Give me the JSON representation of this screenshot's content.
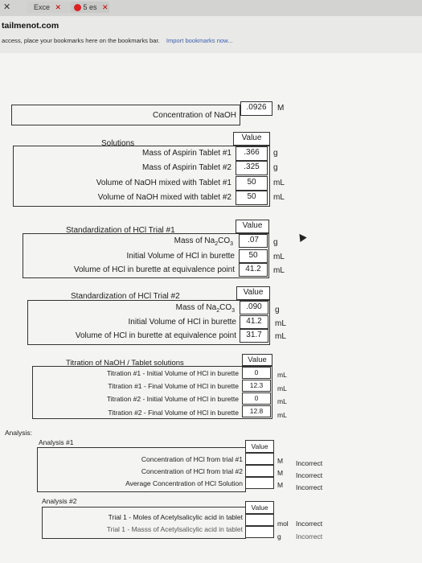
{
  "browser": {
    "tab1": "Exce",
    "tab2": "5 es",
    "url": "tailmenot.com",
    "bookmarks_hint": "access, place your bookmarks here on the bookmarks bar.",
    "bookmarks_link": "Import bookmarks now..."
  },
  "naoh": {
    "label": "Concentration of NaOH",
    "value": ".0926",
    "unit": "M"
  },
  "solutions": {
    "title": "Solutions",
    "value_header": "Value",
    "rows": [
      {
        "label": "Mass of Aspirin Tablet #1",
        "value": ".366",
        "unit": "g"
      },
      {
        "label": "Mass of Aspirin Tablet #2",
        "value": ".325",
        "unit": "g"
      },
      {
        "label": "Volume of NaOH mixed with Tablet #1",
        "value": "50",
        "unit": "mL"
      },
      {
        "label": "Volume of NaOH mixed with tablet #2",
        "value": "50",
        "unit": "mL"
      }
    ]
  },
  "std1": {
    "title": "Standardization of HCl Trial #1",
    "value_header": "Value",
    "rows": [
      {
        "label": "Mass of Na2CO3",
        "value": ".07",
        "unit": "g"
      },
      {
        "label": "Initial Volume of HCl in burette",
        "value": "50",
        "unit": "mL"
      },
      {
        "label": "Volume of HCl in burette at equivalence point",
        "value": "41.2",
        "unit": "mL"
      }
    ]
  },
  "std2": {
    "title": "Standardization of HCl Trial #2",
    "value_header": "Value",
    "rows": [
      {
        "label": "Mass of Na2CO3",
        "value": ".090",
        "unit": "g"
      },
      {
        "label": "Initial Volume of HCl in burette",
        "value": "41.2",
        "unit": "mL"
      },
      {
        "label": "Volume of HCl in burette at equivalence point",
        "value": "31.7",
        "unit": "mL"
      }
    ]
  },
  "titration": {
    "title": "Titration of NaOH / Tablet solutions",
    "value_header": "Value",
    "rows": [
      {
        "label": "Titration #1 - Initial Volume of HCl in burette",
        "value": "0",
        "unit": "mL"
      },
      {
        "label": "Titration #1 - Final Volume of HCl in burette",
        "value": "12.3",
        "unit": "mL"
      },
      {
        "label": "Titration #2 - Initial Volume of HCl in burette",
        "value": "0",
        "unit": "mL"
      },
      {
        "label": "Titration #2 - Final Volume of HCl in burette",
        "value": "12.8",
        "unit": "mL"
      }
    ]
  },
  "analysis": {
    "label": "Analysis:",
    "a1": {
      "title": "Analysis #1",
      "value_header": "Value",
      "rows": [
        {
          "label": "Concentration of HCl from trial #1",
          "unit": "M",
          "status": "Incorrect"
        },
        {
          "label": "Concentration of HCl from trial #2",
          "unit": "M",
          "status": "Incorrect"
        },
        {
          "label": "Average Concentration of HCl Solution",
          "unit": "M",
          "status": "Incorrect"
        }
      ]
    },
    "a2": {
      "title": "Analysis #2",
      "value_header": "Value",
      "rows": [
        {
          "label": "Trial 1 - Moles of Acetylsalicylic acid in tablet",
          "unit": "mol",
          "status": "Incorrect"
        },
        {
          "label": "Trial 1 - Masss of Acetylsalicylic acid in tablet",
          "unit": "g",
          "status": "Incorrect"
        }
      ]
    }
  }
}
